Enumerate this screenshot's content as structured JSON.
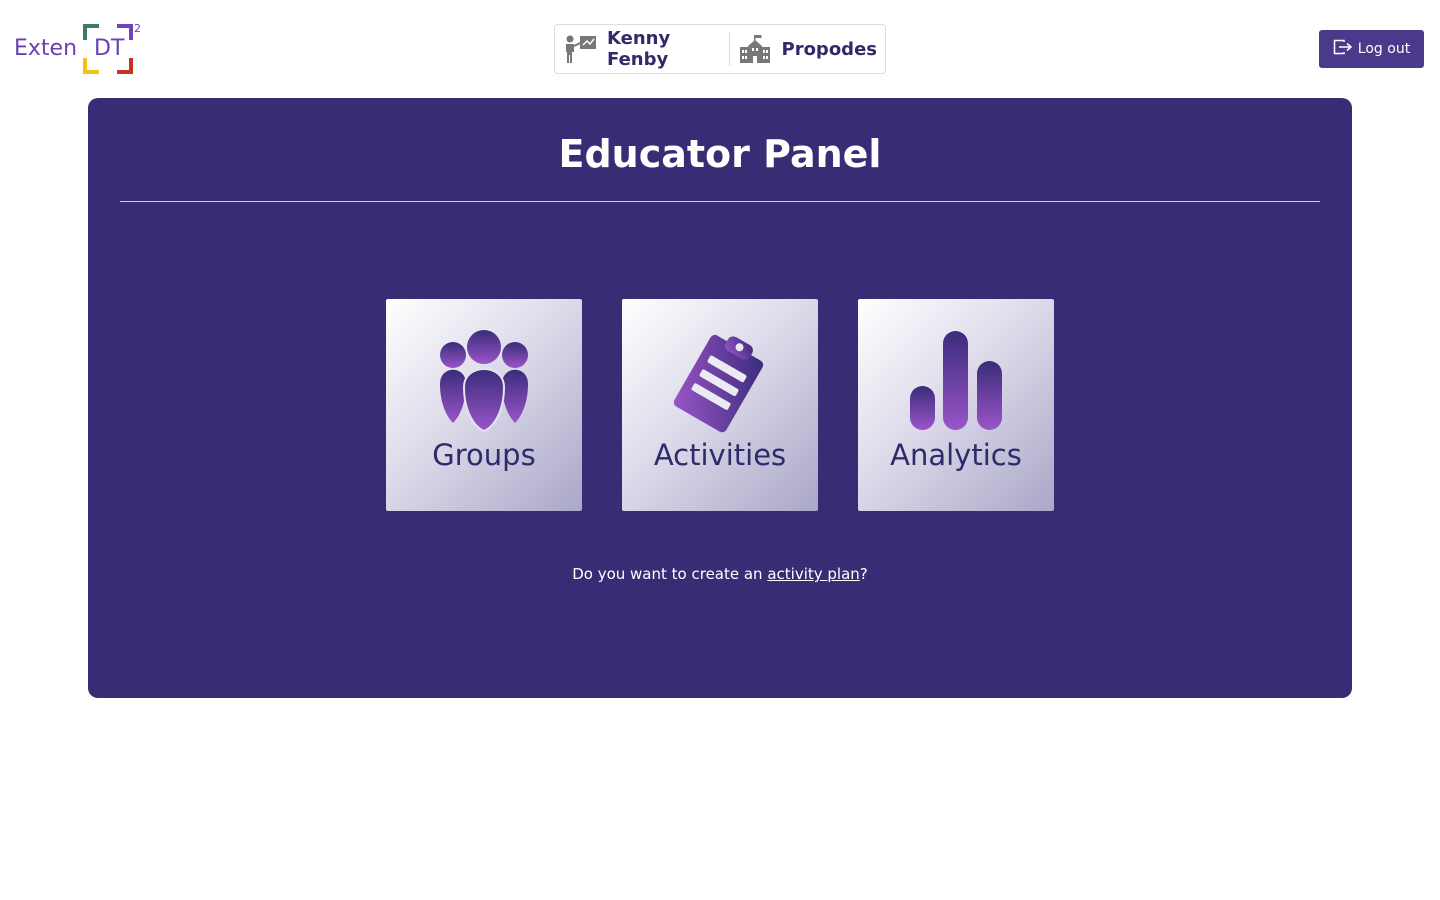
{
  "logo": {
    "prefix": "Exten",
    "core": "DT",
    "sup": "2"
  },
  "user": {
    "name": "Kenny Fenby",
    "school": "Propodes",
    "name_icon": "teacher-icon",
    "school_icon": "school-building-icon"
  },
  "logout": {
    "label": "Log out",
    "icon": "logout-icon"
  },
  "panel": {
    "title": "Educator Panel",
    "tiles": [
      {
        "label": "Groups",
        "icon": "groups-icon"
      },
      {
        "label": "Activities",
        "icon": "clipboard-icon"
      },
      {
        "label": "Analytics",
        "icon": "bar-chart-icon"
      }
    ],
    "prompt_before": "Do you want to create an ",
    "prompt_link": "activity plan",
    "prompt_after": "?"
  },
  "colors": {
    "panel_bg": "#372d74",
    "accent": "#4b3a8c",
    "tile_text": "#2f2a6a",
    "icon_gradient_start": "#3a2c7a",
    "icon_gradient_end": "#9a55c8"
  }
}
